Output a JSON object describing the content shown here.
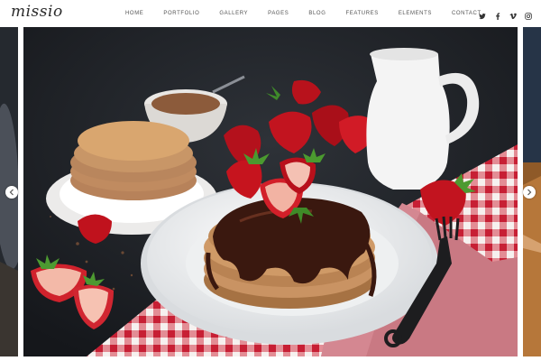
{
  "brand": {
    "logo_text": "missio"
  },
  "nav": {
    "items": [
      {
        "label": "HOME"
      },
      {
        "label": "PORTFOLIO"
      },
      {
        "label": "GALLERY"
      },
      {
        "label": "PAGES"
      },
      {
        "label": "BLOG"
      },
      {
        "label": "FEATURES"
      },
      {
        "label": "ELEMENTS"
      },
      {
        "label": "CONTACT"
      }
    ]
  },
  "social": [
    {
      "icon": "twitter-icon"
    },
    {
      "icon": "facebook-icon"
    },
    {
      "icon": "vimeo-icon"
    },
    {
      "icon": "instagram-icon"
    }
  ],
  "slider": {
    "prev_icon": "chevron-left-icon",
    "next_icon": "chevron-right-icon"
  },
  "colors": {
    "nav_text": "#555555",
    "logo_text": "#2b2b2b",
    "background": "#ffffff"
  }
}
